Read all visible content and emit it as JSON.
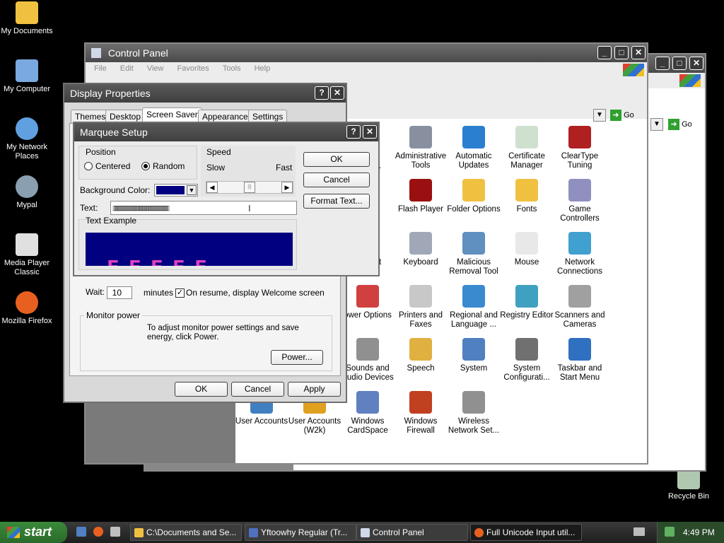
{
  "desktop": {
    "icons": [
      {
        "label": "My Documents",
        "icon": "folder-docs-icon",
        "color": "#f0c040"
      },
      {
        "label": "My Computer",
        "icon": "computer-icon",
        "color": "#7aa8e0"
      },
      {
        "label": "My Network Places",
        "icon": "network-places-icon",
        "color": "#60a0e0"
      },
      {
        "label": "Mypal",
        "icon": "mypal-icon",
        "color": "#8aa0b0"
      },
      {
        "label": "Media Player Classic",
        "icon": "media-player-icon",
        "color": "#e0e0e0"
      },
      {
        "label": "Mozilla Firefox",
        "icon": "firefox-icon",
        "color": "#e86020"
      },
      {
        "label": "Recycle Bin",
        "icon": "recycle-bin-icon",
        "color": "#b0c8b0"
      }
    ]
  },
  "control_panel": {
    "title": "Control Panel",
    "menu": [
      "File",
      "Edit",
      "View",
      "Favorites",
      "Tools",
      "Help"
    ],
    "go_label": "Go",
    "items": [
      {
        "label": "Administrative Tools",
        "icon": "admin-tools-icon",
        "color": "#8890a0"
      },
      {
        "label": "Automatic Updates",
        "icon": "windows-update-icon",
        "color": "#2a7fd0"
      },
      {
        "label": "Certificate Manager",
        "icon": "certificate-icon",
        "color": "#cfe0cf"
      },
      {
        "label": "ClearType Tuning",
        "icon": "cleartype-icon",
        "color": "#b02020"
      },
      {
        "label": "Flash Player",
        "icon": "flash-icon",
        "color": "#9a1010"
      },
      {
        "label": "Folder Options",
        "icon": "folder-options-icon",
        "color": "#f0c040"
      },
      {
        "label": "Fonts",
        "icon": "fonts-folder-icon",
        "color": "#f0c040"
      },
      {
        "label": "Game Controllers",
        "icon": "gamepad-icon",
        "color": "#9090c0"
      },
      {
        "label": "Keyboard",
        "icon": "keyboard-icon",
        "color": "#a0a8b8"
      },
      {
        "label": "Malicious Removal Tool",
        "icon": "removal-tool-icon",
        "color": "#6090c0"
      },
      {
        "label": "Mouse",
        "icon": "mouse-icon",
        "color": "#e8e8e8"
      },
      {
        "label": "Network Connections",
        "icon": "network-connections-icon",
        "color": "#40a0d0"
      },
      {
        "label": "ower Options",
        "icon": "power-options-icon",
        "color": "#d04040"
      },
      {
        "label": "Printers and Faxes",
        "icon": "printer-icon",
        "color": "#c8c8c8"
      },
      {
        "label": "Regional and Language ...",
        "icon": "globe-icon",
        "color": "#3a8ad0"
      },
      {
        "label": "Registry Editor",
        "icon": "registry-icon",
        "color": "#40a0c0"
      },
      {
        "label": "Scanners and Cameras",
        "icon": "scanner-icon",
        "color": "#a0a0a0"
      },
      {
        "label": "Sounds and Audio Devices",
        "icon": "speaker-icon",
        "color": "#909090"
      },
      {
        "label": "Speech",
        "icon": "speech-icon",
        "color": "#e0b040"
      },
      {
        "label": "System",
        "icon": "system-icon",
        "color": "#5080c0"
      },
      {
        "label": "System Configurati...",
        "icon": "system-config-icon",
        "color": "#707070"
      },
      {
        "label": "Taskbar and Start Menu",
        "icon": "taskbar-icon",
        "color": "#3070c0"
      },
      {
        "label": "User Accounts",
        "icon": "user-accounts-icon",
        "color": "#4080c0"
      },
      {
        "label": "User Accounts (W2k)",
        "icon": "user-accounts-w2k-icon",
        "color": "#e0a020"
      },
      {
        "label": "Windows CardSpace",
        "icon": "cardspace-icon",
        "color": "#6080c0"
      },
      {
        "label": "Windows Firewall",
        "icon": "firewall-icon",
        "color": "#c04020"
      },
      {
        "label": "Wireless Network Set...",
        "icon": "wireless-icon",
        "color": "#909090"
      }
    ],
    "partial_labels": [
      ".",
      "t"
    ]
  },
  "display_properties": {
    "title": "Display Properties",
    "tabs": [
      "Themes",
      "Desktop",
      "Screen Saver",
      "Appearance",
      "Settings"
    ],
    "wait_label": "Wait:",
    "wait_value": "10",
    "minutes_label": "minutes",
    "resume_label": "On resume, display Welcome screen",
    "monitor_power_label": "Monitor power",
    "monitor_power_text": "To adjust monitor power settings and save energy, click Power.",
    "power_button": "Power...",
    "ok": "OK",
    "cancel": "Cancel",
    "apply": "Apply"
  },
  "marquee": {
    "title": "Marquee Setup",
    "position_label": "Position",
    "centered_label": "Centered",
    "random_label": "Random",
    "position_selected": "Random",
    "speed_label": "Speed",
    "slow_label": "Slow",
    "fast_label": "Fast",
    "speed_level": 0.5,
    "bg_color_label": "Background Color:",
    "bg_color": "#000080",
    "text_label": "Text:",
    "text_value": "▯▯▯▯▯▯▯▯▯▯▯▯▯▯▯▯▯▯▯▯▯▯▯▯▯▯▯▯▯▯▯▯▯▯▯▯▯▯▯▯",
    "example_label": "Text Example",
    "example_text": "ᴇᴇᴇᴇᴇ",
    "ok": "OK",
    "cancel": "Cancel",
    "format_text": "Format Text..."
  },
  "taskbar": {
    "start_label": "start",
    "tasks": [
      "C:\\Documents and Se...",
      "Yftoowhy Regular (Tr...",
      "Control Panel",
      "Full Unicode Input util..."
    ],
    "clock": "4:49 PM"
  }
}
